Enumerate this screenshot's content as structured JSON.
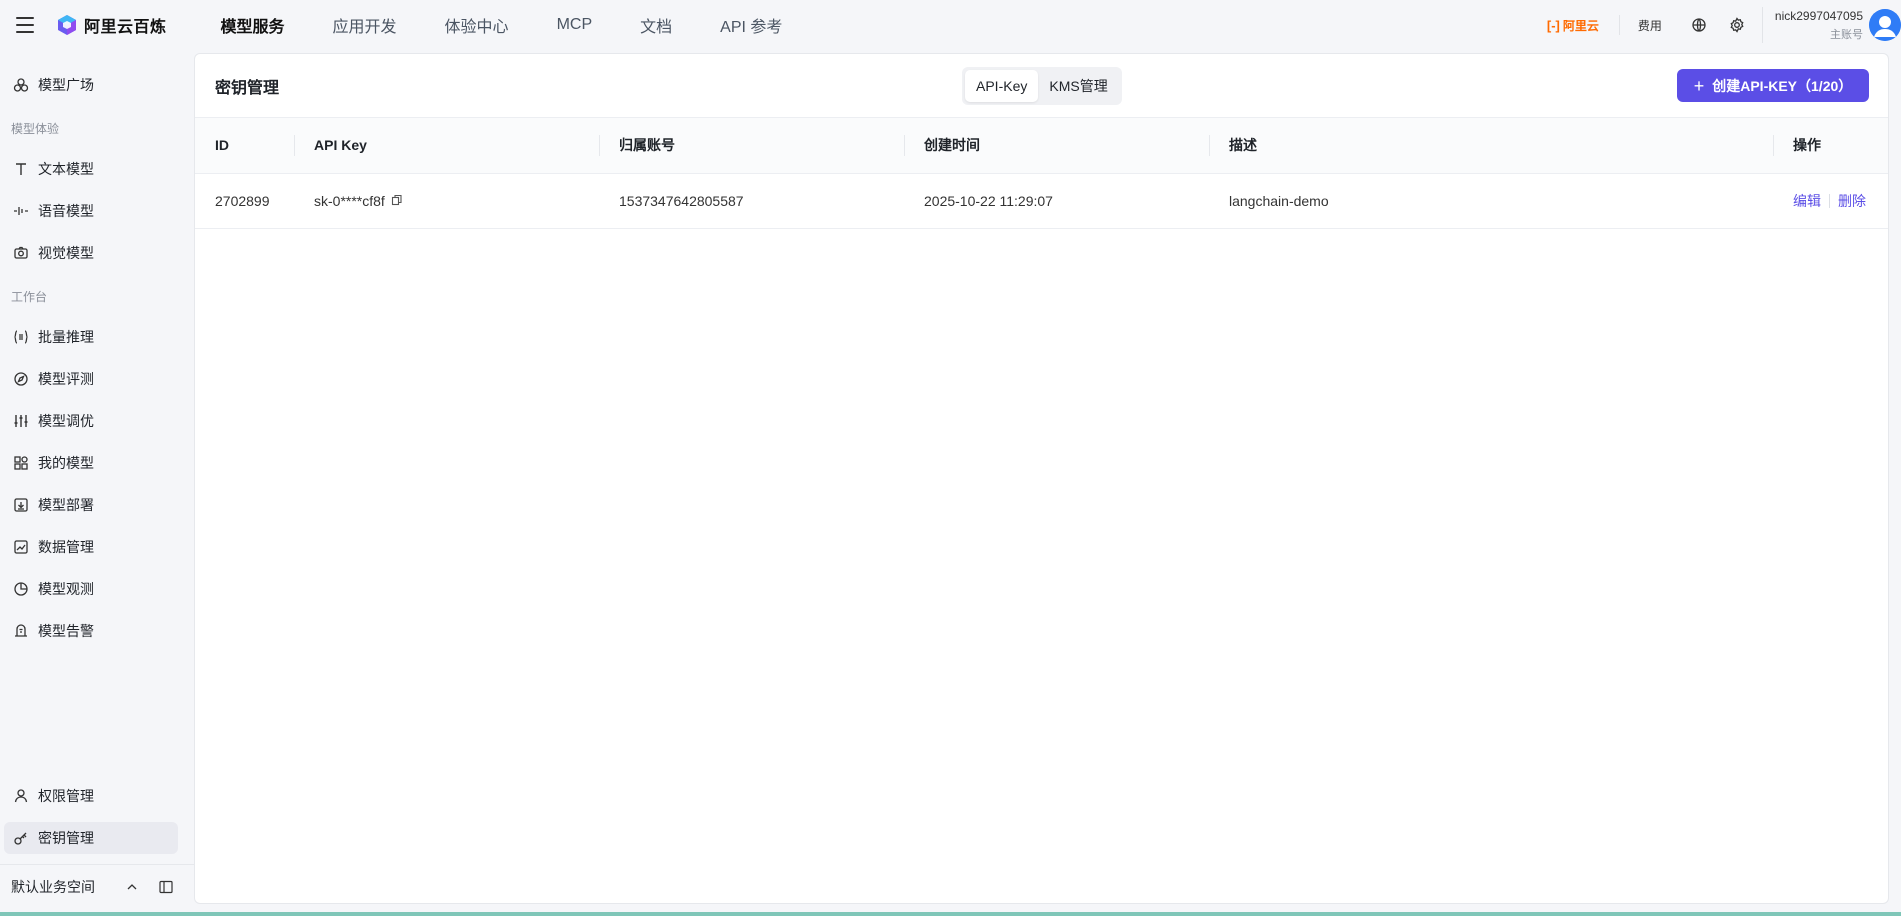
{
  "header": {
    "brand": "阿里云百炼",
    "nav": [
      {
        "label": "模型服务",
        "active": true
      },
      {
        "label": "应用开发",
        "active": false
      },
      {
        "label": "体验中心",
        "active": false
      },
      {
        "label": "MCP",
        "active": false
      },
      {
        "label": "文档",
        "active": false
      },
      {
        "label": "API 参考",
        "active": false
      }
    ],
    "aliyun_logo": "阿里云",
    "fee_label": "费用",
    "user": {
      "name": "nick2997047095",
      "role": "主账号"
    }
  },
  "sidebar": {
    "items": [
      {
        "label": "模型广场",
        "icon": "model-square-icon"
      },
      {
        "label": "文本模型",
        "icon": "text-icon"
      },
      {
        "label": "语音模型",
        "icon": "audio-wave-icon"
      },
      {
        "label": "视觉模型",
        "icon": "camera-icon"
      },
      {
        "label": "批量推理",
        "icon": "batch-icon"
      },
      {
        "label": "模型评测",
        "icon": "compass-icon"
      },
      {
        "label": "模型调优",
        "icon": "sliders-icon"
      },
      {
        "label": "我的模型",
        "icon": "grid-icon"
      },
      {
        "label": "模型部署",
        "icon": "deploy-icon"
      },
      {
        "label": "数据管理",
        "icon": "chart-icon"
      },
      {
        "label": "模型观测",
        "icon": "pie-icon"
      },
      {
        "label": "模型告警",
        "icon": "bell-icon"
      },
      {
        "label": "权限管理",
        "icon": "user-icon"
      },
      {
        "label": "密钥管理",
        "icon": "key-icon",
        "active": true
      }
    ],
    "groups": [
      "模型体验",
      "工作台"
    ],
    "workspace": "默认业务空间"
  },
  "main": {
    "title": "密钥管理",
    "tabs": [
      {
        "label": "API-Key",
        "active": true
      },
      {
        "label": "KMS管理",
        "active": false
      }
    ],
    "create_button": "创建API-KEY（1/20）",
    "table": {
      "columns": [
        "ID",
        "API Key",
        "归属账号",
        "创建时间",
        "描述",
        "操作"
      ],
      "rows": [
        {
          "id": "2702899",
          "api_key": "sk-0****cf8f",
          "account": "1537347642805587",
          "created": "2025-10-22 11:29:07",
          "description": "langchain-demo",
          "edit": "编辑",
          "delete": "删除"
        }
      ]
    }
  },
  "colors": {
    "accent": "#5b4ee6",
    "aliyun": "#ff6a00"
  }
}
